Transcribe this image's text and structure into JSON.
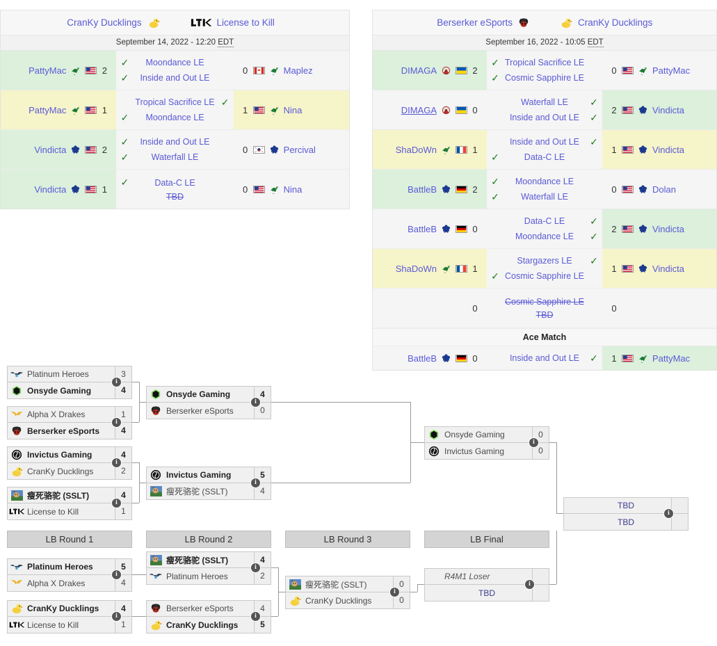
{
  "matches": [
    {
      "id": "match-left",
      "team_left": "CranKy Ducklings",
      "team_left_icon": "duck-logo",
      "team_right": "License to Kill",
      "team_right_icon": "ltk-logo",
      "date": "September 14, 2022 - 12:20 ",
      "timezone": "EDT",
      "rows": [
        {
          "left_player": "PattyMac",
          "left_race": "zerg",
          "left_flag": "us",
          "left_score": "2",
          "left_result": "win",
          "right_player": "Maplez",
          "right_race": "zerg",
          "right_flag": "ca",
          "right_score": "0",
          "right_result": "loss",
          "maps": [
            {
              "name": "Moondance LE",
              "winner": "left"
            },
            {
              "name": "Inside and Out LE",
              "winner": "left"
            }
          ]
        },
        {
          "left_player": "PattyMac",
          "left_race": "zerg",
          "left_flag": "us",
          "left_score": "1",
          "left_result": "draw",
          "right_player": "Nina",
          "right_race": "zerg",
          "right_flag": "us",
          "right_score": "1",
          "right_result": "draw",
          "maps": [
            {
              "name": "Tropical Sacrifice LE",
              "winner": "right"
            },
            {
              "name": "Moondance LE",
              "winner": "left"
            }
          ]
        },
        {
          "left_player": "Vindicta",
          "left_race": "terran",
          "left_flag": "us",
          "left_score": "2",
          "left_result": "win",
          "right_player": "Percival",
          "right_race": "terran",
          "right_flag": "kr",
          "right_score": "0",
          "right_result": "loss",
          "maps": [
            {
              "name": "Inside and Out LE",
              "winner": "left"
            },
            {
              "name": "Waterfall LE",
              "winner": "left"
            }
          ]
        },
        {
          "left_player": "Vindicta",
          "left_race": "terran",
          "left_flag": "us",
          "left_score": "1",
          "left_result": "win",
          "right_player": "Nina",
          "right_race": "zerg",
          "right_flag": "us",
          "right_score": "0",
          "right_result": "loss",
          "maps": [
            {
              "name": "Data-C LE",
              "winner": "left"
            },
            {
              "name": "TBD",
              "winner": "none",
              "cancelled": true
            }
          ]
        }
      ],
      "ace_match_label": null,
      "ace_rows": []
    },
    {
      "id": "match-right",
      "team_left": "Berserker eSports",
      "team_left_icon": "berserker-logo",
      "team_right": "CranKy Ducklings",
      "team_right_icon": "duck-logo",
      "date": "September 16, 2022 - 10:05 ",
      "timezone": "EDT",
      "rows": [
        {
          "left_player": "DIMAGA",
          "left_race": "zerg-alt",
          "left_flag": "ua",
          "left_score": "2",
          "left_result": "win",
          "right_player": "PattyMac",
          "right_race": "zerg",
          "right_flag": "us",
          "right_score": "0",
          "right_result": "loss",
          "maps": [
            {
              "name": "Tropical Sacrifice LE",
              "winner": "left"
            },
            {
              "name": "Cosmic Sapphire LE",
              "winner": "left"
            }
          ]
        },
        {
          "left_player": "DIMAGA",
          "left_race": "zerg-alt",
          "left_flag": "ua",
          "left_score": "0",
          "left_result": "loss",
          "left_underline": true,
          "right_player": "Vindicta",
          "right_race": "terran",
          "right_flag": "us",
          "right_score": "2",
          "right_result": "win",
          "maps": [
            {
              "name": "Waterfall LE",
              "winner": "right"
            },
            {
              "name": "Inside and Out LE",
              "winner": "right"
            }
          ]
        },
        {
          "left_player": "ShaDoWn",
          "left_race": "zerg",
          "left_flag": "fr",
          "left_score": "1",
          "left_result": "draw",
          "right_player": "Vindicta",
          "right_race": "terran",
          "right_flag": "us",
          "right_score": "1",
          "right_result": "draw",
          "maps": [
            {
              "name": "Inside and Out LE",
              "winner": "right"
            },
            {
              "name": "Data-C LE",
              "winner": "left"
            }
          ]
        },
        {
          "left_player": "BattleB",
          "left_race": "terran",
          "left_flag": "de",
          "left_score": "2",
          "left_result": "win",
          "right_player": "Dolan",
          "right_race": "terran",
          "right_flag": "us",
          "right_score": "0",
          "right_result": "loss",
          "maps": [
            {
              "name": "Moondance LE",
              "winner": "left"
            },
            {
              "name": "Waterfall LE",
              "winner": "left"
            }
          ]
        },
        {
          "left_player": "BattleB",
          "left_race": "terran",
          "left_flag": "de",
          "left_score": "0",
          "left_result": "loss",
          "right_player": "Vindicta",
          "right_race": "terran",
          "right_flag": "us",
          "right_score": "2",
          "right_result": "win",
          "maps": [
            {
              "name": "Data-C LE",
              "winner": "right"
            },
            {
              "name": "Moondance LE",
              "winner": "right"
            }
          ]
        },
        {
          "left_player": "ShaDoWn",
          "left_race": "zerg",
          "left_flag": "fr",
          "left_score": "1",
          "left_result": "draw",
          "right_player": "Vindicta",
          "right_race": "terran",
          "right_flag": "us",
          "right_score": "1",
          "right_result": "draw",
          "maps": [
            {
              "name": "Stargazers LE",
              "winner": "right"
            },
            {
              "name": "Cosmic Sapphire LE",
              "winner": "left"
            }
          ]
        },
        {
          "left_player": "",
          "left_race": "none",
          "left_flag": "none",
          "left_score": "0",
          "left_result": "none",
          "right_player": "",
          "right_race": "none",
          "right_flag": "none",
          "right_score": "0",
          "right_result": "none",
          "maps": [
            {
              "name": "Cosmic Sapphire LE",
              "winner": "none",
              "cancelled": true
            },
            {
              "name": "TBD",
              "winner": "none",
              "cancelled": true
            }
          ]
        }
      ],
      "ace_match_label": "Ace Match",
      "ace_rows": [
        {
          "left_player": "BattleB",
          "left_race": "terran",
          "left_flag": "de",
          "left_score": "0",
          "left_result": "loss",
          "right_player": "PattyMac",
          "right_race": "zerg",
          "right_flag": "us",
          "right_score": "1",
          "right_result": "win",
          "maps": [
            {
              "name": "Inside and Out LE",
              "winner": "right"
            }
          ]
        }
      ]
    }
  ],
  "bracket": {
    "round_labels": [
      {
        "text": "LB Round 1"
      },
      {
        "text": "LB Round 2"
      },
      {
        "text": "LB Round 3"
      },
      {
        "text": "LB Final"
      }
    ],
    "boxes": [
      {
        "id": "ub-r1-m1",
        "teams": [
          {
            "name": "Platinum Heroes",
            "logo": "platinum-heroes-logo",
            "score": "3",
            "winner": false
          },
          {
            "name": "Onsyde Gaming",
            "logo": "onsyde-logo",
            "score": "4",
            "winner": true
          }
        ]
      },
      {
        "id": "ub-r1-m2",
        "teams": [
          {
            "name": "Alpha X Drakes",
            "logo": "alpha-x-drakes-logo",
            "score": "1",
            "winner": false
          },
          {
            "name": "Berserker eSports",
            "logo": "berserker-logo",
            "score": "4",
            "winner": true
          }
        ]
      },
      {
        "id": "ub-r1-m3",
        "teams": [
          {
            "name": "Invictus Gaming",
            "logo": "invictus-logo",
            "score": "4",
            "winner": true
          },
          {
            "name": "CranKy Ducklings",
            "logo": "duck-logo",
            "score": "2",
            "winner": false
          }
        ]
      },
      {
        "id": "ub-r1-m4",
        "teams": [
          {
            "name": "瘦死骆驼 (SSLT)",
            "logo": "sslt-logo",
            "score": "4",
            "winner": true
          },
          {
            "name": "License to Kill",
            "logo": "ltk-logo",
            "score": "1",
            "winner": false
          }
        ]
      },
      {
        "id": "ub-r2-m1",
        "teams": [
          {
            "name": "Onsyde Gaming",
            "logo": "onsyde-logo",
            "score": "4",
            "winner": true
          },
          {
            "name": "Berserker eSports",
            "logo": "berserker-logo",
            "score": "0",
            "winner": false
          }
        ]
      },
      {
        "id": "ub-r2-m2",
        "teams": [
          {
            "name": "Invictus Gaming",
            "logo": "invictus-logo",
            "score": "5",
            "winner": true
          },
          {
            "name": "瘦死骆驼 (SSLT)",
            "logo": "sslt-logo",
            "score": "4",
            "winner": false
          }
        ]
      },
      {
        "id": "ub-r3-m1",
        "teams": [
          {
            "name": "Onsyde Gaming",
            "logo": "onsyde-logo",
            "score": "0",
            "winner": false
          },
          {
            "name": "Invictus Gaming",
            "logo": "invictus-logo",
            "score": "0",
            "winner": false
          }
        ]
      },
      {
        "id": "grand-final",
        "teams": [
          {
            "name": "TBD",
            "logo": "none",
            "score": "",
            "winner": false,
            "tbd": true
          },
          {
            "name": "TBD",
            "logo": "none",
            "score": "",
            "winner": false,
            "tbd": true
          }
        ]
      },
      {
        "id": "lb-r1-m1",
        "teams": [
          {
            "name": "Platinum Heroes",
            "logo": "platinum-heroes-logo",
            "score": "5",
            "winner": true
          },
          {
            "name": "Alpha X Drakes",
            "logo": "alpha-x-drakes-logo",
            "score": "4",
            "winner": false
          }
        ]
      },
      {
        "id": "lb-r1-m2",
        "teams": [
          {
            "name": "CranKy Ducklings",
            "logo": "duck-logo",
            "score": "4",
            "winner": true
          },
          {
            "name": "License to Kill",
            "logo": "ltk-logo",
            "score": "1",
            "winner": false
          }
        ]
      },
      {
        "id": "lb-r2-m1",
        "teams": [
          {
            "name": "瘦死骆驼 (SSLT)",
            "logo": "sslt-logo",
            "score": "4",
            "winner": true
          },
          {
            "name": "Platinum Heroes",
            "logo": "platinum-heroes-logo",
            "score": "2",
            "winner": false
          }
        ]
      },
      {
        "id": "lb-r2-m2",
        "teams": [
          {
            "name": "Berserker eSports",
            "logo": "berserker-logo",
            "score": "4",
            "winner": false
          },
          {
            "name": "CranKy Ducklings",
            "logo": "duck-logo",
            "score": "5",
            "winner": true
          }
        ]
      },
      {
        "id": "lb-r3-m1",
        "teams": [
          {
            "name": "瘦死骆驼 (SSLT)",
            "logo": "sslt-logo",
            "score": "0",
            "winner": false
          },
          {
            "name": "CranKy Ducklings",
            "logo": "duck-logo",
            "score": "0",
            "winner": false
          }
        ]
      },
      {
        "id": "lb-final-m1",
        "teams": [
          {
            "name": "R4M1 Loser",
            "logo": "none",
            "score": "",
            "winner": false,
            "italic": true
          },
          {
            "name": "TBD",
            "logo": "none",
            "score": "",
            "winner": false,
            "tbd": true
          }
        ]
      }
    ],
    "info_icon_label": "i"
  }
}
